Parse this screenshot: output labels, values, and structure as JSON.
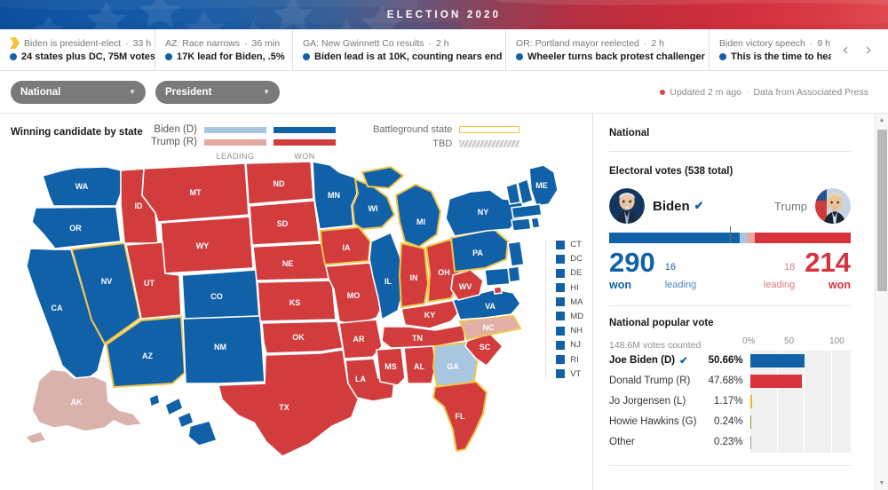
{
  "banner": {
    "title": "ELECTION 2020"
  },
  "ticker": {
    "items": [
      {
        "icon": "flag-icon",
        "headline": "Biden is president-elect",
        "time": "33 h",
        "detail": "24 states plus DC, 75M votes"
      },
      {
        "icon": "dot-icon",
        "headline": "AZ: Race narrows",
        "time": "36 min",
        "detail": "17K lead for Biden, .5%"
      },
      {
        "icon": "dot-icon",
        "headline": "GA: New Gwinnett Co results",
        "time": "2 h",
        "detail": "Biden lead is at 10K, counting nears end"
      },
      {
        "icon": "dot-icon",
        "headline": "OR: Portland mayor reelected",
        "time": "2 h",
        "detail": "Wheeler turns back protest challenger"
      },
      {
        "icon": "dot-icon",
        "headline": "Biden victory speech",
        "time": "9 h",
        "detail": "This is the time to heal in Am…"
      }
    ],
    "prev_label": "‹",
    "next_label": "›"
  },
  "controls": {
    "scope_select": "National",
    "office_select": "President",
    "caret": "▼",
    "updated": "Updated 2 m ago",
    "separator": "·",
    "source": "Data from Associated Press"
  },
  "legend": {
    "title": "Winning candidate by state",
    "rows": [
      {
        "name": "Biden (D)",
        "leading_color": "#a8c6e0",
        "won_color": "#1161a8"
      },
      {
        "name": "Trump (R)",
        "leading_color": "#e4a9a2",
        "won_color": "#d23c3c"
      }
    ],
    "axis": [
      "LEADING",
      "WON"
    ],
    "battleground_label": "Battleground state",
    "tbd_label": "TBD",
    "battleground_color": "#f2c54a"
  },
  "map": {
    "small_states": [
      "CT",
      "DC",
      "DE",
      "HI",
      "MA",
      "MD",
      "NH",
      "NJ",
      "RI",
      "VT"
    ],
    "small_state_color": "#1161a8",
    "colors": {
      "dem_won": "#1161a8",
      "dem_leading": "#a8c6e0",
      "rep_won": "#d23c3c",
      "rep_leading": "#e0b0a8",
      "battleground_outline": "#f2c54a"
    },
    "states": [
      {
        "abbr": "WA",
        "status": "dem_won"
      },
      {
        "abbr": "OR",
        "status": "dem_won"
      },
      {
        "abbr": "CA",
        "status": "dem_won"
      },
      {
        "abbr": "NV",
        "status": "dem_won"
      },
      {
        "abbr": "ID",
        "status": "rep_won"
      },
      {
        "abbr": "MT",
        "status": "rep_won"
      },
      {
        "abbr": "WY",
        "status": "rep_won"
      },
      {
        "abbr": "UT",
        "status": "rep_won"
      },
      {
        "abbr": "AZ",
        "status": "dem_won"
      },
      {
        "abbr": "CO",
        "status": "dem_won"
      },
      {
        "abbr": "NM",
        "status": "dem_won"
      },
      {
        "abbr": "ND",
        "status": "rep_won"
      },
      {
        "abbr": "SD",
        "status": "rep_won"
      },
      {
        "abbr": "NE",
        "status": "rep_won"
      },
      {
        "abbr": "KS",
        "status": "rep_won"
      },
      {
        "abbr": "OK",
        "status": "rep_won"
      },
      {
        "abbr": "TX",
        "status": "rep_won"
      },
      {
        "abbr": "MN",
        "status": "dem_won"
      },
      {
        "abbr": "IA",
        "status": "rep_won"
      },
      {
        "abbr": "MO",
        "status": "rep_won"
      },
      {
        "abbr": "AR",
        "status": "rep_won"
      },
      {
        "abbr": "LA",
        "status": "rep_won"
      },
      {
        "abbr": "WI",
        "status": "dem_won"
      },
      {
        "abbr": "IL",
        "status": "dem_won"
      },
      {
        "abbr": "MI",
        "status": "dem_won"
      },
      {
        "abbr": "IN",
        "status": "rep_won"
      },
      {
        "abbr": "OH",
        "status": "rep_won"
      },
      {
        "abbr": "KY",
        "status": "rep_won"
      },
      {
        "abbr": "TN",
        "status": "rep_won"
      },
      {
        "abbr": "MS",
        "status": "rep_won"
      },
      {
        "abbr": "AL",
        "status": "rep_won"
      },
      {
        "abbr": "GA",
        "status": "dem_leading"
      },
      {
        "abbr": "FL",
        "status": "rep_won"
      },
      {
        "abbr": "SC",
        "status": "rep_won"
      },
      {
        "abbr": "NC",
        "status": "rep_leading"
      },
      {
        "abbr": "VA",
        "status": "dem_won"
      },
      {
        "abbr": "WV",
        "status": "rep_won"
      },
      {
        "abbr": "PA",
        "status": "dem_won"
      },
      {
        "abbr": "NY",
        "status": "dem_won"
      },
      {
        "abbr": "ME",
        "status": "dem_won"
      },
      {
        "abbr": "AK",
        "status": "rep_leading"
      }
    ]
  },
  "side": {
    "heading": "National",
    "electoral": {
      "title": "Electoral votes (538 total)",
      "dem": {
        "name": "Biden",
        "check": "✔",
        "won": "290",
        "won_label": "won",
        "leading": "16",
        "leading_label": "leading",
        "color": "#1161a8"
      },
      "rep": {
        "name": "Trump",
        "won": "214",
        "won_label": "won",
        "leading": "18",
        "leading_label": "leading",
        "color": "#d8323c"
      },
      "total": 538,
      "majority_marker": 270
    },
    "popular": {
      "title": "National popular vote",
      "votes_counted": "148.6M votes counted",
      "axis": [
        "0%",
        "50",
        "100"
      ],
      "rows": [
        {
          "name": "Joe Biden (D)",
          "check": "✔",
          "pct": "50.66%",
          "value": 50.66,
          "color": "#1161a8",
          "leader": true
        },
        {
          "name": "Donald Trump (R)",
          "check": "",
          "pct": "47.68%",
          "value": 47.68,
          "color": "#d8323c",
          "leader": false
        },
        {
          "name": "Jo Jorgensen (L)",
          "check": "",
          "pct": "1.17%",
          "value": 1.17,
          "color": "#f0b323",
          "leader": false
        },
        {
          "name": "Howie Hawkins (G)",
          "check": "",
          "pct": "0.24%",
          "value": 0.24,
          "color": "#7a9e3a",
          "leader": false
        },
        {
          "name": "Other",
          "check": "",
          "pct": "0.23%",
          "value": 0.23,
          "color": "#999999",
          "leader": false
        }
      ]
    }
  },
  "scrollbar": {
    "up": "▲",
    "down": "▼"
  }
}
